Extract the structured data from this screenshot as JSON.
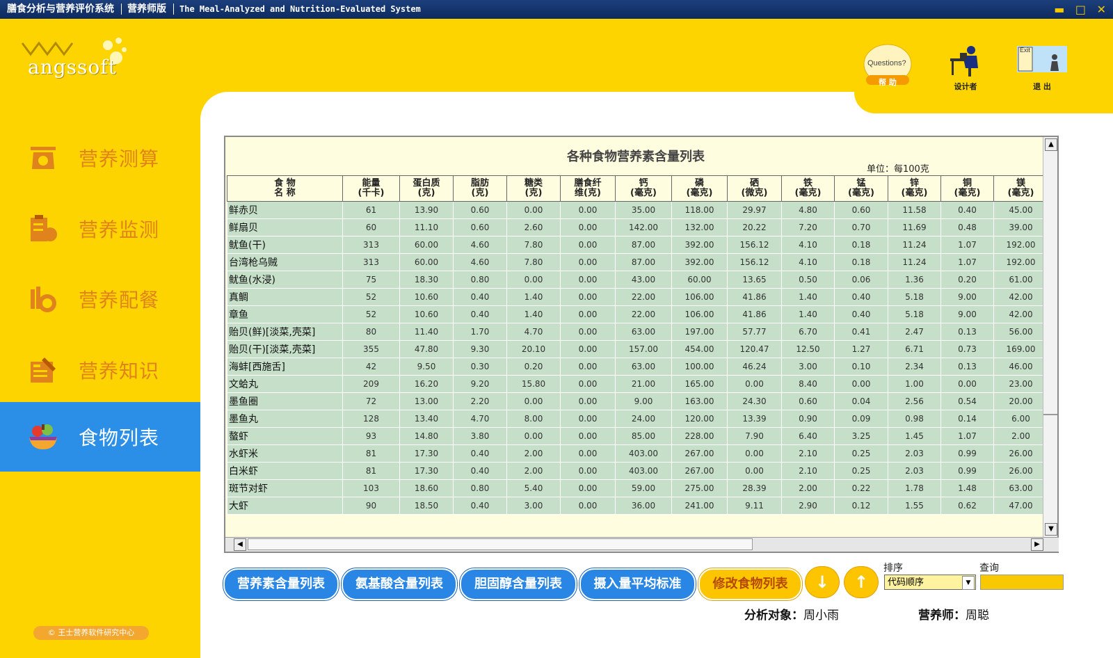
{
  "titlebar": {
    "app_name": "膳食分析与营养评价系统",
    "edition": "营养师版",
    "english_name": "The Meal-Analyzed and Nutrition-Evaluated System",
    "minimize": "▬",
    "maximize": "□",
    "close": "✕"
  },
  "logo": {
    "text": "angssoft"
  },
  "top_buttons": [
    {
      "icon": "help-icon",
      "label": "帮 助",
      "badge": "Questions?"
    },
    {
      "icon": "designer-icon",
      "label": "设计者"
    },
    {
      "icon": "exit-icon",
      "label": "退 出",
      "badge": "Exit"
    }
  ],
  "sidebar": {
    "items": [
      {
        "label": "营养测算",
        "icon": "scale-icon",
        "active": false
      },
      {
        "label": "营养监测",
        "icon": "clipboard-apple-icon",
        "active": false
      },
      {
        "label": "营养配餐",
        "icon": "meal-icon",
        "active": false
      },
      {
        "label": "营养知识",
        "icon": "book-icon",
        "active": false
      },
      {
        "label": "食物列表",
        "icon": "food-bowl-icon",
        "active": true
      }
    ],
    "copyright": "© 王士营养软件研究中心"
  },
  "table": {
    "title": "各种食物营养素含量列表",
    "unit": "单位：每100克",
    "columns": [
      "食  物\n名  称",
      "能量\n(千卡)",
      "蛋白质\n(克)",
      "脂肪\n(克)",
      "糖类\n(克)",
      "膳食纤\n维(克)",
      "钙\n(毫克)",
      "磷\n(毫克)",
      "硒\n(微克)",
      "铁\n(毫克)",
      "锰\n(毫克)",
      "锌\n(毫克)",
      "铜\n(毫克)",
      "镁\n(毫克)"
    ],
    "rows": [
      [
        "鲜赤贝",
        "61",
        "13.90",
        "0.60",
        "0.00",
        "0.00",
        "35.00",
        "118.00",
        "29.97",
        "4.80",
        "0.60",
        "11.58",
        "0.40",
        "45.00"
      ],
      [
        "鲜扇贝",
        "60",
        "11.10",
        "0.60",
        "2.60",
        "0.00",
        "142.00",
        "132.00",
        "20.22",
        "7.20",
        "0.70",
        "11.69",
        "0.48",
        "39.00"
      ],
      [
        "鱿鱼(干)",
        "313",
        "60.00",
        "4.60",
        "7.80",
        "0.00",
        "87.00",
        "392.00",
        "156.12",
        "4.10",
        "0.18",
        "11.24",
        "1.07",
        "192.00"
      ],
      [
        "台湾枪乌贼",
        "313",
        "60.00",
        "4.60",
        "7.80",
        "0.00",
        "87.00",
        "392.00",
        "156.12",
        "4.10",
        "0.18",
        "11.24",
        "1.07",
        "192.00"
      ],
      [
        "鱿鱼(水浸)",
        "75",
        "18.30",
        "0.80",
        "0.00",
        "0.00",
        "43.00",
        "60.00",
        "13.65",
        "0.50",
        "0.06",
        "1.36",
        "0.20",
        "61.00"
      ],
      [
        "真鲷",
        "52",
        "10.60",
        "0.40",
        "1.40",
        "0.00",
        "22.00",
        "106.00",
        "41.86",
        "1.40",
        "0.40",
        "5.18",
        "9.00",
        "42.00"
      ],
      [
        "章鱼",
        "52",
        "10.60",
        "0.40",
        "1.40",
        "0.00",
        "22.00",
        "106.00",
        "41.86",
        "1.40",
        "0.40",
        "5.18",
        "9.00",
        "42.00"
      ],
      [
        "贻贝(鲜)[淡菜,壳菜]",
        "80",
        "11.40",
        "1.70",
        "4.70",
        "0.00",
        "63.00",
        "197.00",
        "57.77",
        "6.70",
        "0.41",
        "2.47",
        "0.13",
        "56.00"
      ],
      [
        "贻贝(干)[淡菜,壳菜]",
        "355",
        "47.80",
        "9.30",
        "20.10",
        "0.00",
        "157.00",
        "454.00",
        "120.47",
        "12.50",
        "1.27",
        "6.71",
        "0.73",
        "169.00"
      ],
      [
        "海蚌[西施舌]",
        "42",
        "9.50",
        "0.30",
        "0.20",
        "0.00",
        "63.00",
        "100.00",
        "46.24",
        "3.00",
        "0.10",
        "2.34",
        "0.13",
        "46.00"
      ],
      [
        "文蛤丸",
        "209",
        "16.20",
        "9.20",
        "15.80",
        "0.00",
        "21.00",
        "165.00",
        "0.00",
        "8.40",
        "0.00",
        "1.00",
        "0.00",
        "23.00"
      ],
      [
        "墨鱼圈",
        "72",
        "13.00",
        "2.20",
        "0.00",
        "0.00",
        "9.00",
        "163.00",
        "24.30",
        "0.60",
        "0.04",
        "2.56",
        "0.54",
        "20.00"
      ],
      [
        "墨鱼丸",
        "128",
        "13.40",
        "4.70",
        "8.00",
        "0.00",
        "24.00",
        "120.00",
        "13.39",
        "0.90",
        "0.09",
        "0.98",
        "0.14",
        "6.00"
      ],
      [
        "螯虾",
        "93",
        "14.80",
        "3.80",
        "0.00",
        "0.00",
        "85.00",
        "228.00",
        "7.90",
        "6.40",
        "3.25",
        "1.45",
        "1.07",
        "2.00"
      ],
      [
        "水虾米",
        "81",
        "17.30",
        "0.40",
        "2.00",
        "0.00",
        "403.00",
        "267.00",
        "0.00",
        "2.10",
        "0.25",
        "2.03",
        "0.99",
        "26.00"
      ],
      [
        "白米虾",
        "81",
        "17.30",
        "0.40",
        "2.00",
        "0.00",
        "403.00",
        "267.00",
        "0.00",
        "2.10",
        "0.25",
        "2.03",
        "0.99",
        "26.00"
      ],
      [
        "斑节对虾",
        "103",
        "18.60",
        "0.80",
        "5.40",
        "0.00",
        "59.00",
        "275.00",
        "28.39",
        "2.00",
        "0.22",
        "1.78",
        "1.48",
        "63.00"
      ],
      [
        "大虾",
        "90",
        "18.50",
        "0.40",
        "3.00",
        "0.00",
        "36.00",
        "241.00",
        "9.11",
        "2.90",
        "0.12",
        "1.55",
        "0.62",
        "47.00"
      ]
    ]
  },
  "actions": {
    "nutrient_list": "营养素含量列表",
    "amino_list": "氨基酸含量列表",
    "cholesterol_list": "胆固醇含量列表",
    "intake_standard": "摄入量平均标准",
    "edit_food_list": "修改食物列表",
    "down_arrow": "↓",
    "up_arrow": "↑"
  },
  "sort": {
    "label": "排序",
    "value": "代码顺序"
  },
  "query": {
    "label": "查询",
    "value": ""
  },
  "footer": {
    "subject_label": "分析对象：",
    "subject_value": "周小雨",
    "dietitian_label": "营养师：",
    "dietitian_value": "周聪"
  }
}
